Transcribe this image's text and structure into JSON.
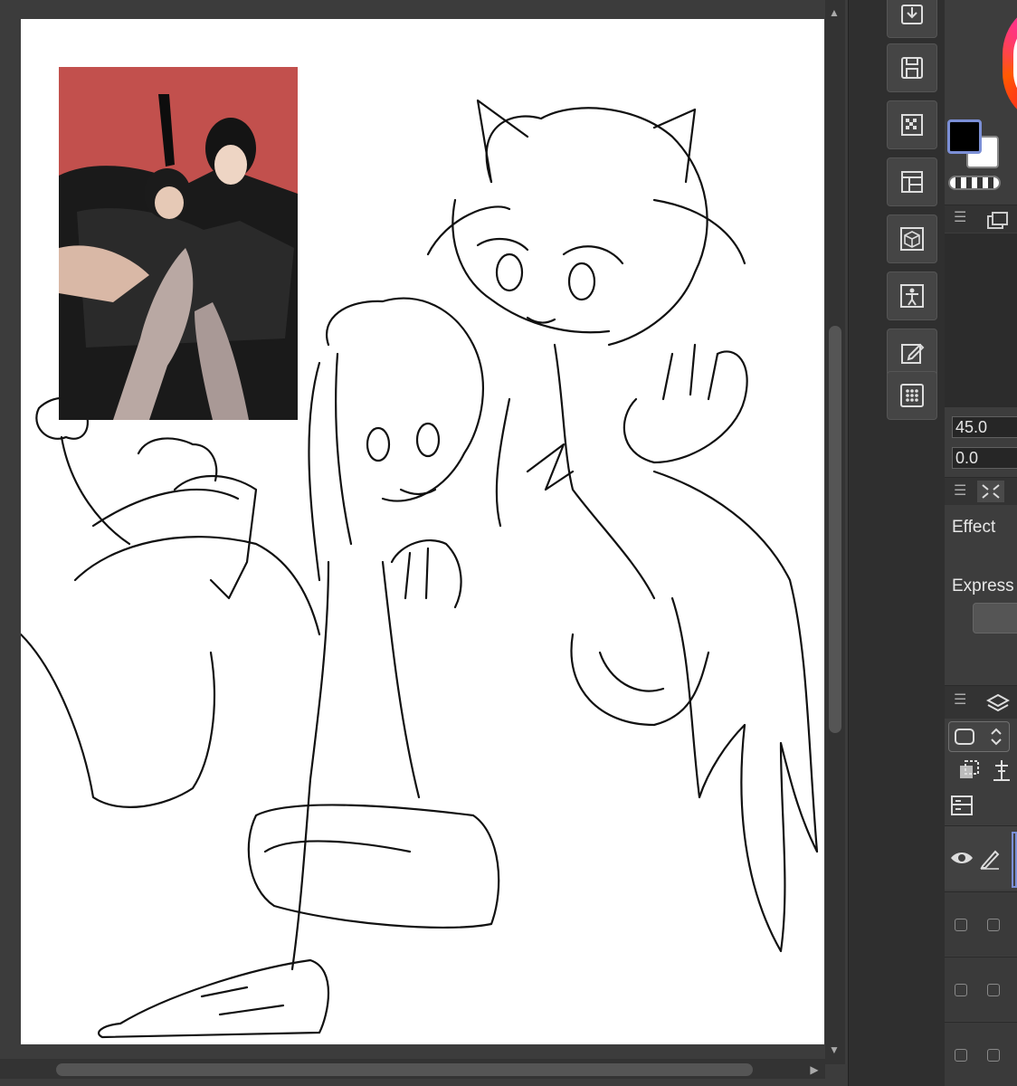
{
  "panel": {
    "tool_property_values": [
      "45.0",
      "0.0"
    ],
    "section_effect": "Effect",
    "section_expression": "Express"
  },
  "icons": {
    "command_bar": [
      "import-icon",
      "save-icon",
      "transparency-icon",
      "layout-icon",
      "3d-object-icon",
      "figure-icon",
      "edit-icon",
      "grid-icon"
    ],
    "panel": [
      "menu-icon",
      "layer-icon",
      "eye-icon",
      "pen-icon"
    ]
  },
  "colors": {
    "main_color": "#000000",
    "sub_color": "#ffffff",
    "ui_background": "#3a3a3a",
    "canvas": "#ffffff",
    "accent": "#7b8fd6"
  }
}
